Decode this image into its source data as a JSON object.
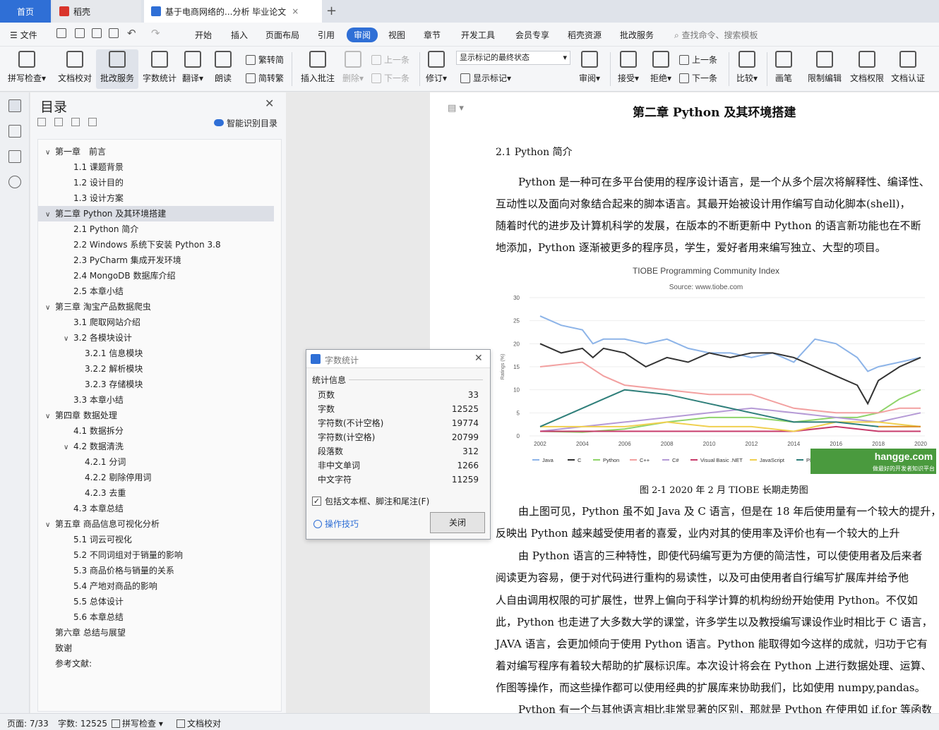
{
  "tabs": {
    "home": "首页",
    "daoke": "稻壳",
    "doc": "基于电商网络的...分析 毕业论文"
  },
  "menu": {
    "file": "文件",
    "items": [
      "开始",
      "插入",
      "页面布局",
      "引用",
      "审阅",
      "视图",
      "章节",
      "开发工具",
      "会员专享",
      "稻壳资源",
      "批改服务"
    ],
    "search": "查找命令、搜索模板"
  },
  "ribbon": {
    "spell": "拼写检查",
    "proof": "文档校对",
    "correct": "批改服务",
    "wordcount": "字数统计",
    "translate": "翻译",
    "read": "朗读",
    "trad": "繁转简",
    "simp": "简转繁",
    "insert_comment": "插入批注",
    "delete": "删除",
    "prev": "上一条",
    "next": "下一条",
    "revise": "修订",
    "markup_state": "显示标记的最终状态",
    "show_markup": "显示标记",
    "review": "审阅",
    "accept": "接受",
    "reject": "拒绝",
    "prev2": "上一条",
    "next2": "下一条",
    "compare": "比较",
    "pen": "画笔",
    "restrict": "限制编辑",
    "perm": "文档权限",
    "cert": "文档认证"
  },
  "toc": {
    "title": "目录",
    "smart": "智能识别目录",
    "items": [
      {
        "label": "第一章　前言",
        "level": 0,
        "arrow": "v"
      },
      {
        "label": "1.1 课题背景",
        "level": 1,
        "arrow": ""
      },
      {
        "label": "1.2 设计目的",
        "level": 1,
        "arrow": ""
      },
      {
        "label": "1.3 设计方案",
        "level": 1,
        "arrow": ""
      },
      {
        "label": "第二章  Python 及其环境搭建",
        "level": 0,
        "arrow": "v",
        "selected": true
      },
      {
        "label": "2.1 Python 简介",
        "level": 1,
        "arrow": ""
      },
      {
        "label": "2.2 Windows 系统下安装 Python 3.8",
        "level": 1,
        "arrow": ""
      },
      {
        "label": "2.3 PyCharm 集成开发环境",
        "level": 1,
        "arrow": ""
      },
      {
        "label": "2.4 MongoDB 数据库介绍",
        "level": 1,
        "arrow": ""
      },
      {
        "label": "2.5  本章小结",
        "level": 1,
        "arrow": ""
      },
      {
        "label": "第三章  淘宝产品数据爬虫",
        "level": 0,
        "arrow": "v"
      },
      {
        "label": "3.1  爬取网站介绍",
        "level": 1,
        "arrow": ""
      },
      {
        "label": "3.2  各模块设计",
        "level": 1,
        "arrow": "v"
      },
      {
        "label": "3.2.1  信息模块",
        "level": 2,
        "arrow": ""
      },
      {
        "label": "3.2.2 解析模块",
        "level": 2,
        "arrow": ""
      },
      {
        "label": "3.2.3  存储模块",
        "level": 2,
        "arrow": ""
      },
      {
        "label": "3.3  本章小结",
        "level": 1,
        "arrow": ""
      },
      {
        "label": "第四章  数据处理",
        "level": 0,
        "arrow": "v"
      },
      {
        "label": "4.1  数据拆分",
        "level": 1,
        "arrow": ""
      },
      {
        "label": "4.2  数据清洗",
        "level": 1,
        "arrow": "v"
      },
      {
        "label": "4.2.1  分词",
        "level": 2,
        "arrow": ""
      },
      {
        "label": "4.2.2 剔除停用词",
        "level": 2,
        "arrow": ""
      },
      {
        "label": "4.2.3  去重",
        "level": 2,
        "arrow": ""
      },
      {
        "label": "4.3  本章总结",
        "level": 1,
        "arrow": ""
      },
      {
        "label": "第五章  商品信息可视化分析",
        "level": 0,
        "arrow": "v"
      },
      {
        "label": "5.1  词云可视化",
        "level": 1,
        "arrow": ""
      },
      {
        "label": "5.2  不同词组对于销量的影响",
        "level": 1,
        "arrow": ""
      },
      {
        "label": "5.3  商品价格与销量的关系",
        "level": 1,
        "arrow": ""
      },
      {
        "label": "5.4 产地对商品的影响",
        "level": 1,
        "arrow": ""
      },
      {
        "label": "5.5 总体设计",
        "level": 1,
        "arrow": ""
      },
      {
        "label": "5.6  本章总结",
        "level": 1,
        "arrow": ""
      },
      {
        "label": "第六章  总结与展望",
        "level": 0,
        "arrow": ""
      },
      {
        "label": "致谢",
        "level": 0,
        "arrow": ""
      },
      {
        "label": "参考文献:",
        "level": 0,
        "arrow": ""
      }
    ]
  },
  "doc": {
    "chapter_title": "第二章  Python 及其环境搭建",
    "section": "2.1 Python 简介",
    "p1": [
      "Python 是一种可在多平台使用的程序设计语言，是一个从多个层次将解释性、编译性、",
      "互动性以及面向对象结合起来的脚本语言。其最开始被设计用作编写自动化脚本(shell)，",
      "随着时代的进步及计算机科学的发展，在版本的不断更新中 Python 的语言新功能也在不断",
      "地添加，Python 逐渐被更多的程序员，学生，爱好者用来编写独立、大型的项目。"
    ],
    "caption": "图 2-1    2020 年 2 月 TIOBE 长期走势图",
    "p2": [
      "由上图可见，Python 虽不如 Java 及 C 语言，但是在 18 年后使用量有一个较大的提升，",
      "反映出 Python 越来越受使用者的喜爱，业内对其的使用率及评价也有一个较大的上升"
    ],
    "p3": [
      "由 Python 语言的三种特性，即使代码编写更为方便的简洁性，可以使使用者及后来者",
      "阅读更为容易，便于对代码进行重构的易读性，以及可由使用者自行编写扩展库并给予他",
      "人自由调用权限的可扩展性，世界上偏向于科学计算的机构纷纷开始使用 Python。不仅如",
      "此，Python 也走进了大多数大学的课堂，许多学生以及教授编写课设作业时相比于 C 语言，",
      "JAVA 语言，会更加倾向于使用 Python 语言。Python 能取得如今这样的成就，归功于它有",
      "着对编写程序有着较大帮助的扩展标识库。本次设计将会在 Python 上进行数据处理、运算、",
      "作图等操作，而这些操作都可以使用经典的扩展库来协助我们，比如使用 numpy,pandas。"
    ],
    "p4": "Python 有一个与其他语言相比非常显著的区别，那就是 Python 在使用如 if,for 等函数"
  },
  "chart_data": {
    "type": "line",
    "title": "TIOBE Programming Community Index",
    "subtitle": "Source: www.tiobe.com",
    "ylabel": "Ratings (%)",
    "x_ticks": [
      "2002",
      "2004",
      "2006",
      "2008",
      "2010",
      "2012",
      "2014",
      "2016",
      "2018",
      "2020"
    ],
    "y_ticks": [
      "0",
      "5",
      "10",
      "15",
      "20",
      "25",
      "30"
    ],
    "ylim": [
      0,
      30
    ],
    "xlim": [
      2001.5,
      2020.2
    ],
    "watermark": "hangge.com",
    "watermark_sub": "做最好的开发者知识平台",
    "series": [
      {
        "name": "Java",
        "color": "#8db4e8",
        "x": [
          2002,
          2003,
          2004,
          2004.5,
          2005,
          2006,
          2007,
          2008,
          2009,
          2010,
          2011,
          2012,
          2013,
          2014,
          2015,
          2016,
          2017,
          2017.5,
          2018,
          2019,
          2020
        ],
        "y": [
          26,
          24,
          23,
          20,
          21,
          21,
          20,
          21,
          19,
          18,
          18,
          17,
          18,
          16,
          21,
          20,
          17,
          14,
          15,
          16,
          17
        ]
      },
      {
        "name": "C",
        "color": "#333333",
        "x": [
          2002,
          2003,
          2004,
          2004.5,
          2005,
          2006,
          2007,
          2008,
          2009,
          2010,
          2011,
          2012,
          2013,
          2014,
          2015,
          2016,
          2017,
          2017.5,
          2018,
          2019,
          2020
        ],
        "y": [
          20,
          18,
          19,
          17,
          19,
          18,
          15,
          17,
          16,
          18,
          17,
          18,
          18,
          17,
          15,
          13,
          11,
          7,
          12,
          15,
          17
        ]
      },
      {
        "name": "Python",
        "color": "#8fd46a",
        "x": [
          2002,
          2004,
          2006,
          2008,
          2010,
          2012,
          2014,
          2016,
          2017,
          2018,
          2019,
          2020
        ],
        "y": [
          1,
          0.8,
          1.5,
          3,
          4,
          4,
          3,
          4,
          4,
          5,
          8,
          10
        ]
      },
      {
        "name": "C++",
        "color": "#f2a0a0",
        "x": [
          2002,
          2004,
          2005,
          2006,
          2008,
          2010,
          2012,
          2014,
          2016,
          2018,
          2019,
          2020
        ],
        "y": [
          15,
          16,
          13,
          11,
          10,
          9,
          9,
          6,
          5,
          5,
          6,
          6
        ]
      },
      {
        "name": "C#",
        "color": "#b59ad6",
        "x": [
          2002,
          2004,
          2006,
          2008,
          2010,
          2012,
          2014,
          2016,
          2018,
          2020
        ],
        "y": [
          1,
          2,
          3,
          4,
          5,
          6,
          5,
          4,
          3,
          5
        ]
      },
      {
        "name": "Visual Basic .NET",
        "color": "#c73b6b",
        "x": [
          2002,
          2006,
          2010,
          2012,
          2014,
          2016,
          2018,
          2020
        ],
        "y": [
          1,
          1,
          1,
          1,
          1,
          2,
          1,
          1
        ]
      },
      {
        "name": "JavaScript",
        "color": "#f0d050",
        "x": [
          2002,
          2004,
          2006,
          2008,
          2010,
          2012,
          2014,
          2016,
          2018,
          2020
        ],
        "y": [
          2,
          2,
          2,
          3,
          2,
          2,
          1,
          3,
          3,
          2
        ]
      },
      {
        "name": "PHP",
        "color": "#2f7f7a",
        "x": [
          2002,
          2003,
          2004,
          2005,
          2006,
          2008,
          2010,
          2012,
          2014,
          2016,
          2018,
          2020
        ],
        "y": [
          2,
          4,
          6,
          8,
          10,
          9,
          7,
          5,
          3,
          3,
          2,
          2
        ]
      },
      {
        "name": "SQL",
        "color": "#e8942c",
        "x": [
          2018,
          2019,
          2020
        ],
        "y": [
          2,
          2,
          2
        ]
      }
    ]
  },
  "dialog": {
    "title": "字数统计",
    "section": "统计信息",
    "rows": [
      {
        "label": "页数",
        "value": "33"
      },
      {
        "label": "字数",
        "value": "12525"
      },
      {
        "label": "字符数(不计空格)",
        "value": "19774"
      },
      {
        "label": "字符数(计空格)",
        "value": "20799"
      },
      {
        "label": "段落数",
        "value": "312"
      },
      {
        "label": "非中文单词",
        "value": "1266"
      },
      {
        "label": "中文字符",
        "value": "11259"
      }
    ],
    "checkbox": "包括文本框、脚注和尾注(F)",
    "tips": "操作技巧",
    "close": "关闭"
  },
  "status": {
    "page": "页面: 7/33",
    "words": "字数: 12525",
    "spell": "拼写检查",
    "proof": "文档校对"
  },
  "colors": {
    "accent": "#2f6fd6",
    "tab_bg": "#dfe3ea"
  }
}
